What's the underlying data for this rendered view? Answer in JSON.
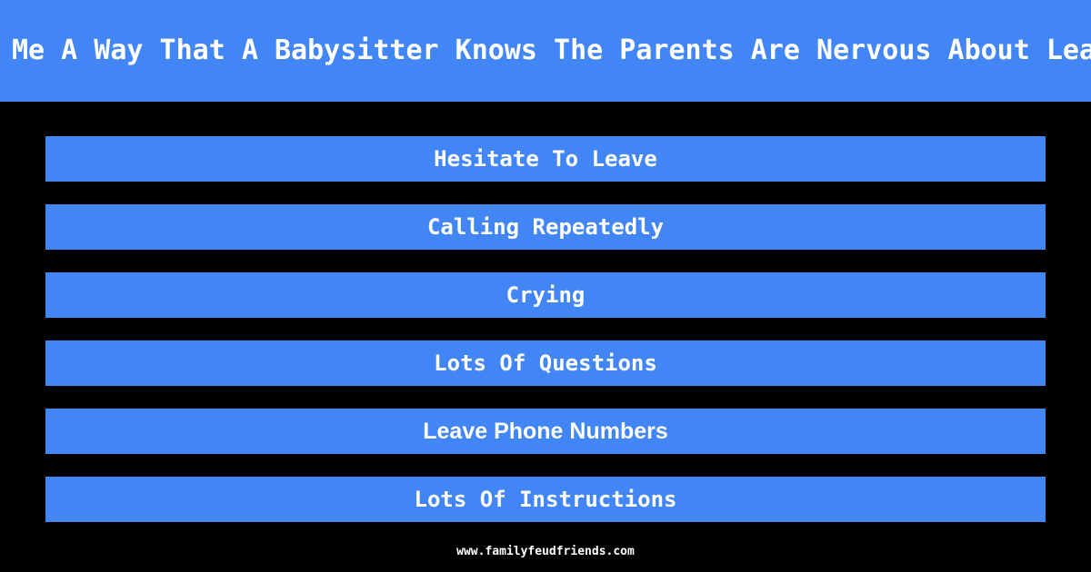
{
  "theme": {
    "background_color": "#000000",
    "accent_color": "#4285f4",
    "text_color": "#ffffff"
  },
  "header": {
    "title": "Tell Me A Way That A Babysitter Knows The Parents Are Nervous About Leaving"
  },
  "answers": [
    {
      "label": "Hesitate To Leave"
    },
    {
      "label": "Calling Repeatedly"
    },
    {
      "label": "Crying"
    },
    {
      "label": "Lots Of Questions"
    },
    {
      "label": "Leave Phone Numbers"
    },
    {
      "label": "Lots Of Instructions"
    }
  ],
  "footer": {
    "site_url": "www.familyfeudfriends.com"
  }
}
